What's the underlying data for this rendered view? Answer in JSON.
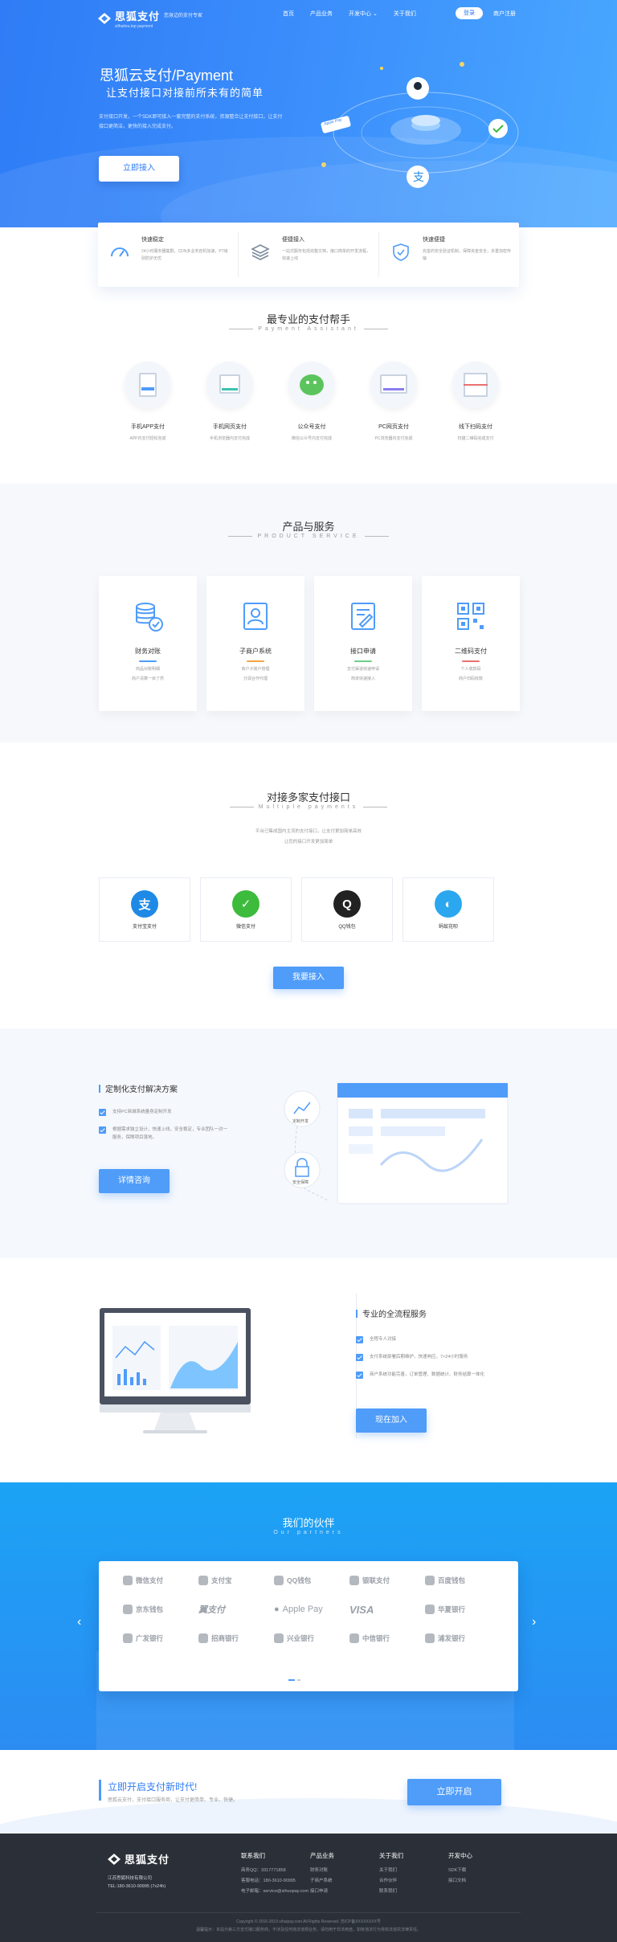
{
  "header": {
    "logo_name": "思狐支付",
    "logo_sub": "silhuitou.top payment",
    "slogan": "您身边的支付专家",
    "nav": [
      "首页",
      "产品业务",
      "开发中心",
      "关于我们"
    ],
    "login": "登录",
    "register": "商户注册"
  },
  "hero": {
    "title": "思狐云支付/Payment",
    "subtitle": "让支付接口对接前所未有的简单",
    "desc": "支付接口开发，一个SDK即可接入一套完整的支付系统，资源整合让支付接口，让支付接口更简洁，更快的接入完成支付。",
    "button": "立即接入",
    "badge": "Apple Pay"
  },
  "features": [
    {
      "title": "快速稳定",
      "desc": "24小时服务器集群，CDN多业务宕机加速，PT级别防护无忧"
    },
    {
      "title": "便捷接入",
      "desc": "一站式服务包括完整文档，接口简单的开发流程，快速上线"
    },
    {
      "title": "快速便捷",
      "desc": "完善的安全验证机制，保障资金安全，多重加密传输"
    }
  ],
  "assistant": {
    "title": "最专业的支付帮手",
    "subtitle": "Payment Assistant",
    "items": [
      {
        "title": "手机APP支付",
        "desc": "APP内支付轻松完成"
      },
      {
        "title": "手机网页支付",
        "desc": "手机浏览器内支付完成"
      },
      {
        "title": "公众号支付",
        "desc": "微信公众号内支付完成"
      },
      {
        "title": "PC网页支付",
        "desc": "PC浏览器内支付完成"
      },
      {
        "title": "线下扫码支付",
        "desc": "扫描二维码完成支付"
      }
    ]
  },
  "product": {
    "title": "产品与服务",
    "subtitle": "PRODUCT SERVICE",
    "cards": [
      {
        "title": "财务对账",
        "d1": "商品对账明细",
        "d2": "商户清算一目了然",
        "color": "#4f9cf9"
      },
      {
        "title": "子商户系统",
        "d1": "商户子账户管理",
        "d2": "分润合作代理",
        "color": "#f7a442"
      },
      {
        "title": "接口申请",
        "d1": "支付渠道快速申请",
        "d2": "简单快速接入",
        "color": "#6bcf8a"
      },
      {
        "title": "二维码支付",
        "d1": "个人收款码",
        "d2": "商户扫码收款",
        "color": "#e96f6f"
      }
    ]
  },
  "multi": {
    "title": "对接多家支付接口",
    "subtitle": "Multiple payments",
    "desc1": "平台已集成国内主流的支付接口，让支付更加简单高效",
    "desc2": "让您的接口开发更加简单",
    "pays": [
      {
        "name": "支付宝支付",
        "glyph": "支",
        "color": "#1f8ae6"
      },
      {
        "name": "微信支付",
        "glyph": "✓",
        "color": "#3dbb3d"
      },
      {
        "name": "QQ钱包",
        "glyph": "Q",
        "color": "#222222"
      },
      {
        "name": "蚂蚁花呗",
        "glyph": "◐",
        "color": "#2aa7ee"
      }
    ],
    "button": "我要接入"
  },
  "custom": {
    "title": "定制化支付解决方案",
    "items": [
      "支持PC商城系统量身定制开发",
      "根据需求独立设计，快速上线，安全稳定，专业团队一对一服务，保障项目落地。"
    ],
    "button": "详情咨询",
    "badge1": "定制开发",
    "badge2": "安全保障"
  },
  "service": {
    "title": "专业的全流程服务",
    "items": [
      "全程专人对接",
      "支付系统部署后期维护，快速响应，7×24小时服务",
      "商户系统功能完善，订单管理、数据统计、财务结算一体化"
    ],
    "button": "现在加入"
  },
  "partners": {
    "title": "我们的伙伴",
    "subtitle": "Our partners",
    "logos": [
      "微信支付",
      "支付宝",
      "QQ钱包",
      "银联支付",
      "百度钱包",
      "京东钱包",
      "翼支付",
      "Apple Pay",
      "VISA",
      "华夏银行",
      "广发银行",
      "招商银行",
      "兴业银行",
      "中信银行",
      "浦发银行"
    ]
  },
  "cta": {
    "title": "立即开启支付新时代!",
    "desc": "思狐云支付，支付接口服务商，让支付更简单、专业、快捷。",
    "button": "立即开启"
  },
  "footer": {
    "company": "江苏思狐科技有限公司",
    "phone": "TEL:180-3610-90995 (7x24h)",
    "cols": [
      {
        "head": "联系我们",
        "lines": [
          "商务QQ：3317771858",
          "客服电话：180-3610-90995",
          "电子邮箱：service@sihuopay.com"
        ]
      },
      {
        "head": "产品业务",
        "lines": [
          "财务对账",
          "子商户系统",
          "接口申请"
        ]
      },
      {
        "head": "关于我们",
        "lines": [
          "关于我们",
          "合作伙伴",
          "联系我们"
        ]
      },
      {
        "head": "开发中心",
        "lines": [
          "SDK下载",
          "接口文档"
        ]
      }
    ],
    "copyright": "Copyright © 2016-2019 sihuipay.com All Rights Reserved. 苏ICP备XXXXXXXX号",
    "disclaimer": "温馨提示：本站为第三方支付接口服务商，不涉及任何违法违规业务，请勿用于非法用途，如有违法行为将依法追究法律责任。"
  }
}
